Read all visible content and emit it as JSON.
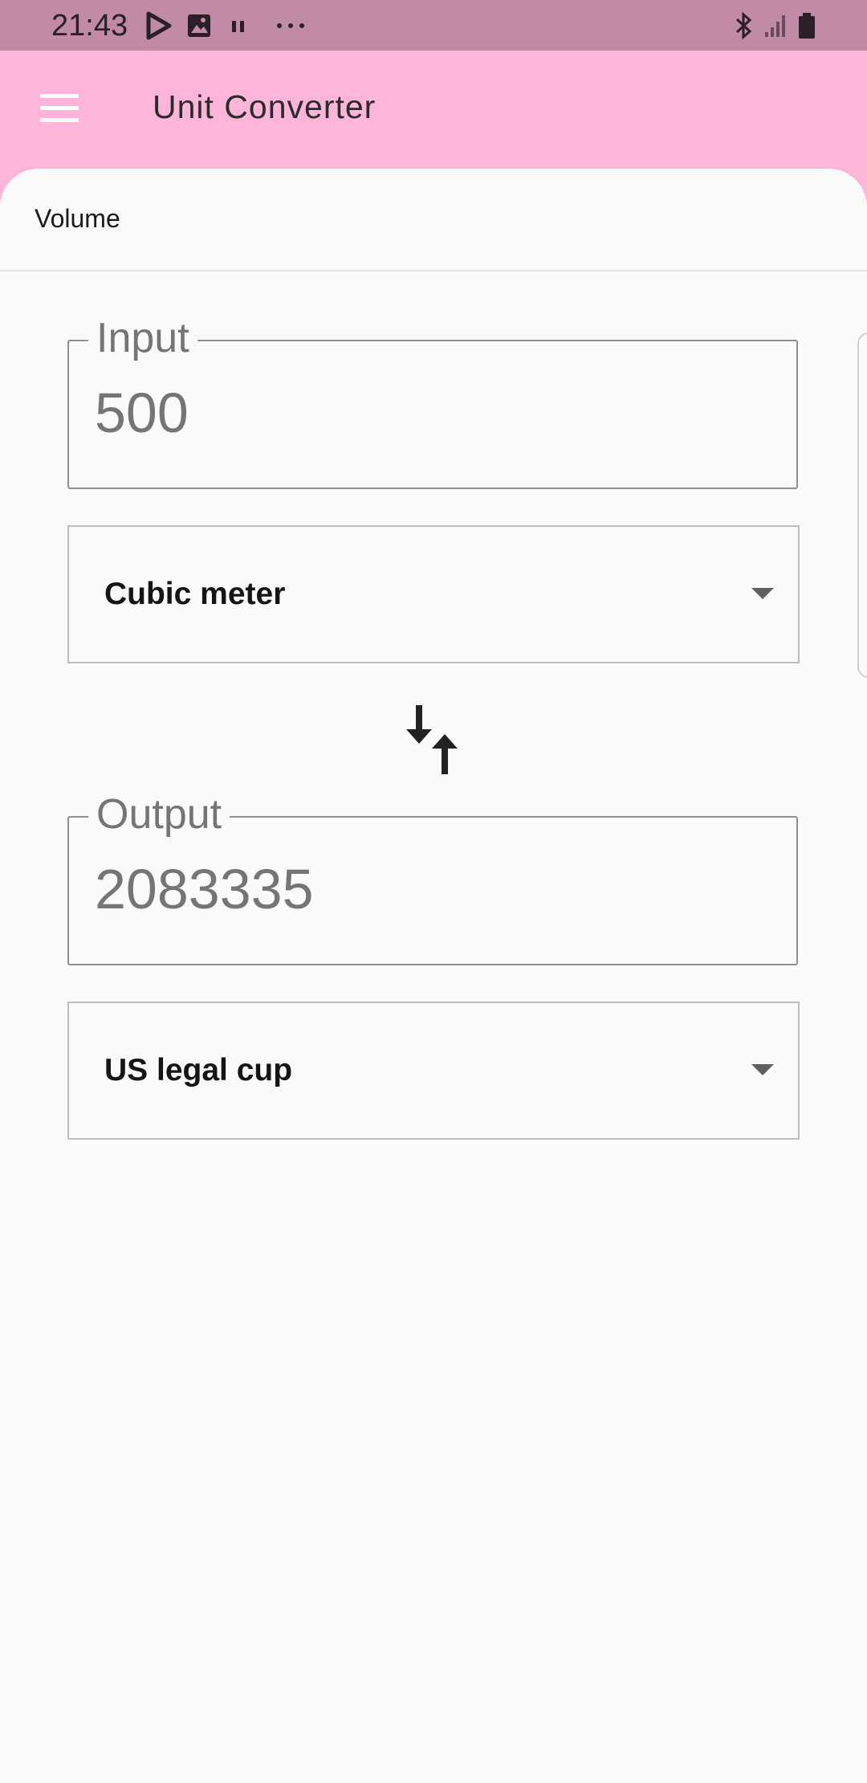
{
  "status_bar": {
    "time": "21:43",
    "left_icons": [
      "play-store-icon",
      "gallery-icon",
      "pause-icon",
      "more-dots-icon"
    ],
    "right_icons": [
      "bluetooth-icon",
      "signal-icon",
      "battery-icon"
    ]
  },
  "app_bar": {
    "title": "Unit Converter",
    "menu_icon": "hamburger-menu-icon",
    "background": "#FFB5DA"
  },
  "category": {
    "selected": "Volume"
  },
  "input": {
    "label": "Input",
    "value": "500",
    "unit": "Cubic meter"
  },
  "swap": {
    "icon": "swap-vertical-icon"
  },
  "output": {
    "label": "Output",
    "value": "2083335",
    "unit": "US legal cup"
  },
  "colors": {
    "status_bar": "#C18AA7",
    "background": "#FAFAFA",
    "field_border": "#8E8E8E",
    "label_text": "#757575"
  }
}
